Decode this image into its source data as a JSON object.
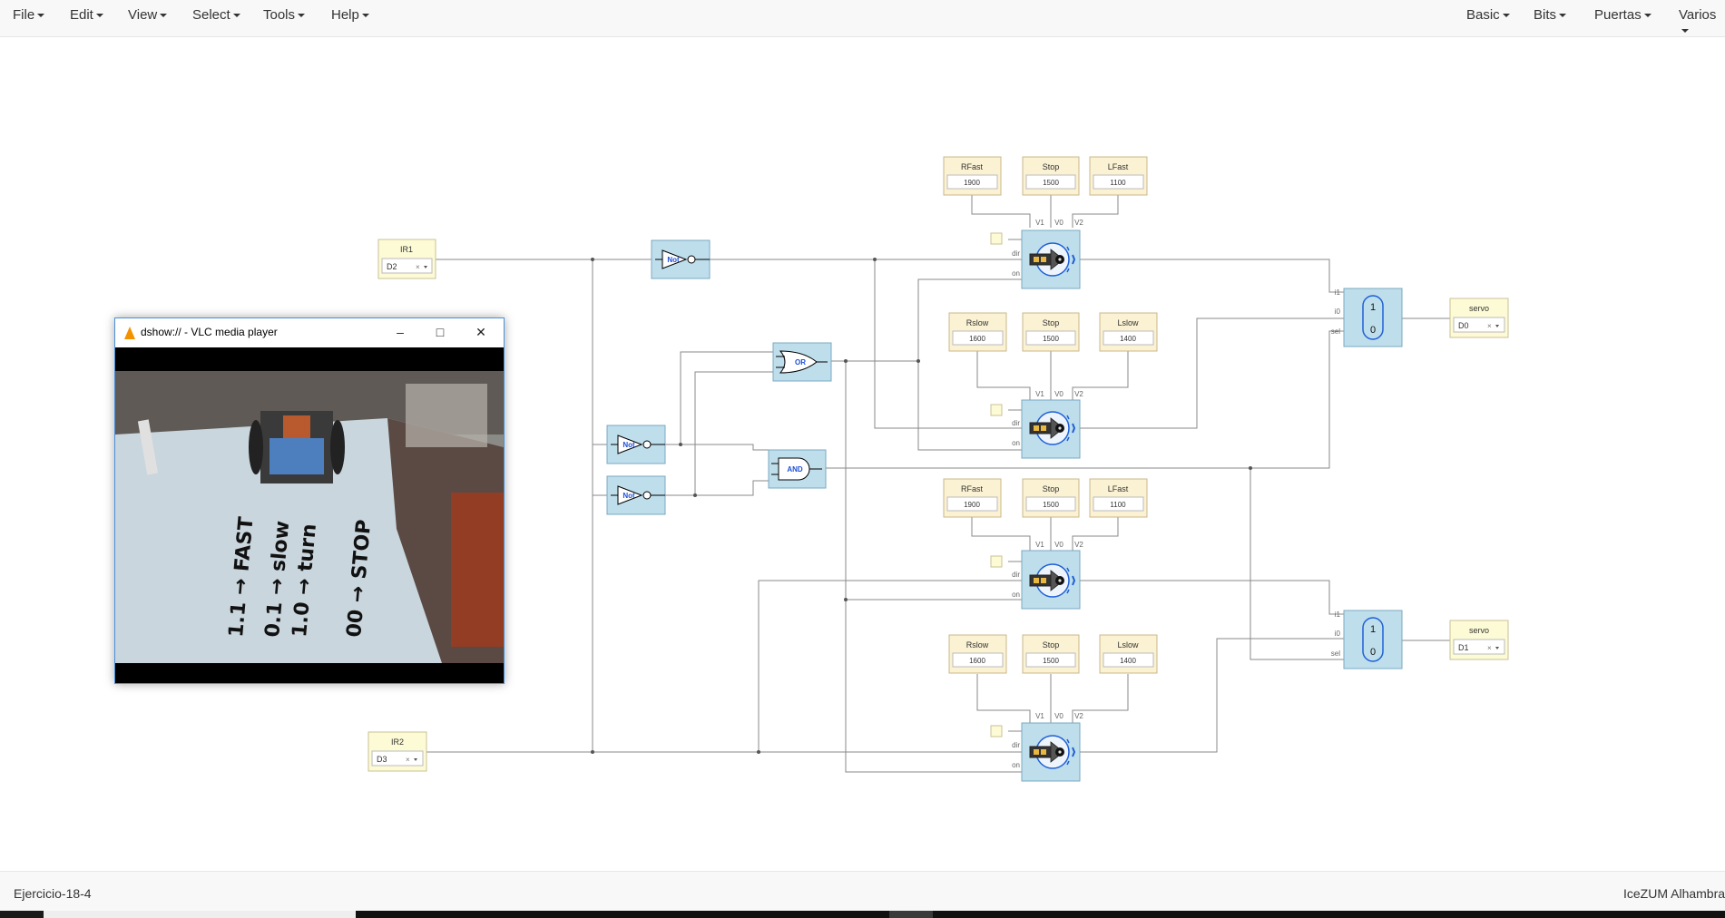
{
  "menubar": {
    "left": [
      {
        "label": "File"
      },
      {
        "label": "Edit"
      },
      {
        "label": "View"
      },
      {
        "label": "Select"
      },
      {
        "label": "Tools"
      },
      {
        "label": "Help"
      }
    ],
    "right": [
      {
        "label": "Basic"
      },
      {
        "label": "Bits"
      },
      {
        "label": "Puertas"
      },
      {
        "label": "Varios"
      }
    ]
  },
  "circuit": {
    "inputs": [
      {
        "label": "IR1",
        "value": "D2"
      },
      {
        "label": "IR2",
        "value": "D3"
      }
    ],
    "outputs": [
      {
        "label": "servo",
        "value": "D0"
      },
      {
        "label": "servo",
        "value": "D1"
      }
    ],
    "constants": [
      {
        "label": "RFast",
        "value": "1900"
      },
      {
        "label": "Stop",
        "value": "1500"
      },
      {
        "label": "LFast",
        "value": "1100"
      },
      {
        "label": "Rslow",
        "value": "1600"
      },
      {
        "label": "Stop",
        "value": "1500"
      },
      {
        "label": "Lslow",
        "value": "1400"
      },
      {
        "label": "RFast",
        "value": "1900"
      },
      {
        "label": "Stop",
        "value": "1500"
      },
      {
        "label": "LFast",
        "value": "1100"
      },
      {
        "label": "Rslow",
        "value": "1600"
      },
      {
        "label": "Stop",
        "value": "1500"
      },
      {
        "label": "Lslow",
        "value": "1400"
      }
    ],
    "gates": {
      "not": "Not",
      "or": "OR",
      "and": "AND"
    },
    "port_labels": {
      "v1": "V1",
      "v0": "V0",
      "v2": "V2",
      "dir": "dir",
      "on": "on",
      "i1": "i1",
      "i0": "i0",
      "sel": "sel"
    },
    "mux_labels": {
      "top": "1",
      "bottom": "0"
    },
    "clear_icon": "×"
  },
  "vlc": {
    "title": "dshow:// - VLC media player",
    "video_caption": [
      "1.1 → FAST",
      "0.1 → slow",
      "1.0 → turn",
      "00 → STOP"
    ]
  },
  "footer": {
    "left": "Ejercicio-18-4",
    "right": "IceZUM Alhambra"
  },
  "colors": {
    "constant_block": "#fbf1d3",
    "io_block": "#fdfbd6",
    "logic_block": "#bfdeec",
    "wire": "#888888",
    "vlc_accent": "#f39200"
  }
}
